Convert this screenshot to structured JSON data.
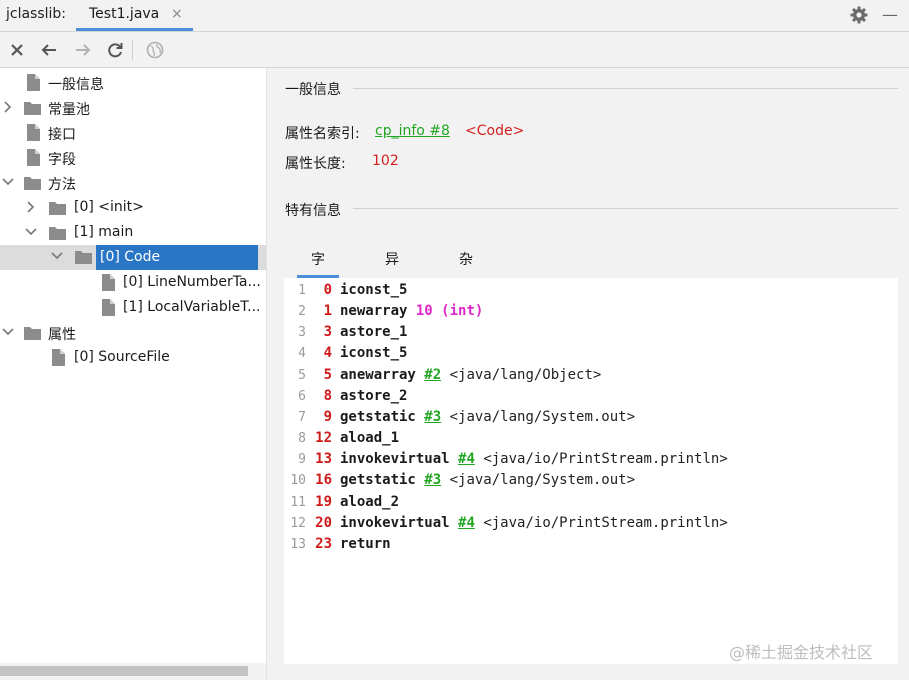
{
  "app_label": "jclasslib:",
  "tab": {
    "label": "Test1.java",
    "close": "×"
  },
  "window": {
    "minimize": "—"
  },
  "colors": {
    "selection": "#2a76c6",
    "link": "#22a622",
    "red": "#d22020",
    "arg": "#e025c8",
    "tab_accent": "#4a8fd8"
  },
  "toolbar": {
    "icons": [
      "close-icon",
      "back-arrow-icon",
      "forward-arrow-icon",
      "refresh-icon",
      "web-icon"
    ]
  },
  "tree": {
    "items": [
      {
        "label": "一般信息",
        "type": "file",
        "expander": "none",
        "selected": false
      },
      {
        "label": "常量池",
        "type": "folder",
        "expander": "collapsed",
        "selected": false
      },
      {
        "label": "接口",
        "type": "file",
        "expander": "none",
        "selected": false
      },
      {
        "label": "字段",
        "type": "file",
        "expander": "none",
        "selected": false
      },
      {
        "label": "方法",
        "type": "folder",
        "expander": "expanded",
        "selected": false
      },
      {
        "label": "[0] <init>",
        "type": "folder",
        "expander": "collapsed",
        "selected": false
      },
      {
        "label": "[1] main",
        "type": "folder",
        "expander": "expanded",
        "selected": false
      },
      {
        "label": "[0] Code",
        "type": "folder",
        "expander": "expanded",
        "selected": true
      },
      {
        "label": "[0] LineNumberTa...",
        "type": "file",
        "expander": "none",
        "selected": false
      },
      {
        "label": "[1] LocalVariableT...",
        "type": "file",
        "expander": "none",
        "selected": false
      },
      {
        "label": "属性",
        "type": "folder",
        "expander": "expanded",
        "selected": false
      },
      {
        "label": "[0] SourceFile",
        "type": "file",
        "expander": "none",
        "selected": false
      }
    ]
  },
  "general": {
    "title": "一般信息",
    "attr_name_label": "属性名索引:",
    "attr_name_link": "cp_info #8",
    "attr_name_value": "<Code>",
    "attr_len_label": "属性长度:",
    "attr_len_value": "102"
  },
  "specific": {
    "title": "特有信息",
    "tabs": [
      "字节码",
      "异常表",
      "杂项"
    ],
    "active_tab": "字节码"
  },
  "code": {
    "lines": [
      {
        "n": "1",
        "off": "0",
        "op": "iconst_5",
        "arg": "",
        "ref": "",
        "comment": ""
      },
      {
        "n": "2",
        "off": "1",
        "op": "newarray",
        "arg": "10 (int)",
        "ref": "",
        "comment": ""
      },
      {
        "n": "3",
        "off": "3",
        "op": "astore_1",
        "arg": "",
        "ref": "",
        "comment": ""
      },
      {
        "n": "4",
        "off": "4",
        "op": "iconst_5",
        "arg": "",
        "ref": "",
        "comment": ""
      },
      {
        "n": "5",
        "off": "5",
        "op": "anewarray",
        "arg": "",
        "ref": "#2",
        "comment": "<java/lang/Object>"
      },
      {
        "n": "6",
        "off": "8",
        "op": "astore_2",
        "arg": "",
        "ref": "",
        "comment": ""
      },
      {
        "n": "7",
        "off": "9",
        "op": "getstatic",
        "arg": "",
        "ref": "#3",
        "comment": "<java/lang/System.out>"
      },
      {
        "n": "8",
        "off": "12",
        "op": "aload_1",
        "arg": "",
        "ref": "",
        "comment": ""
      },
      {
        "n": "9",
        "off": "13",
        "op": "invokevirtual",
        "arg": "",
        "ref": "#4",
        "comment": "<java/io/PrintStream.println>"
      },
      {
        "n": "10",
        "off": "16",
        "op": "getstatic",
        "arg": "",
        "ref": "#3",
        "comment": "<java/lang/System.out>"
      },
      {
        "n": "11",
        "off": "19",
        "op": "aload_2",
        "arg": "",
        "ref": "",
        "comment": ""
      },
      {
        "n": "12",
        "off": "20",
        "op": "invokevirtual",
        "arg": "",
        "ref": "#4",
        "comment": "<java/io/PrintStream.println>"
      },
      {
        "n": "13",
        "off": "23",
        "op": "return",
        "arg": "",
        "ref": "",
        "comment": ""
      }
    ]
  },
  "watermark": "@稀土掘金技术社区"
}
